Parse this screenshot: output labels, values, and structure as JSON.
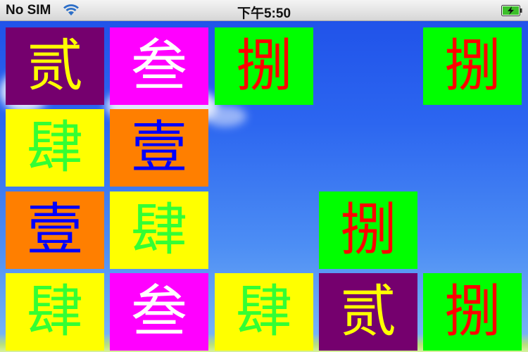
{
  "status_bar": {
    "carrier": "No SIM",
    "time": "下午5:50",
    "wifi_icon": "wifi-icon",
    "battery_icon": "battery-charging-icon"
  },
  "colors": {
    "purple": "#75006e",
    "magenta": "#ff00ff",
    "green": "#00ff00",
    "yellow": "#ffff00",
    "orange": "#ff7f00"
  },
  "tiles": {
    "r1c1": "贰",
    "r1c2": "叁",
    "r1c3": "捌",
    "r1c5": "捌",
    "r2c1": "肆",
    "r2c2": "壹",
    "r3c1": "壹",
    "r3c2": "肆",
    "r3c4": "捌",
    "r4c1": "肆",
    "r4c2": "叁",
    "r4c3": "肆",
    "r4c4": "贰",
    "r4c5": "捌"
  }
}
